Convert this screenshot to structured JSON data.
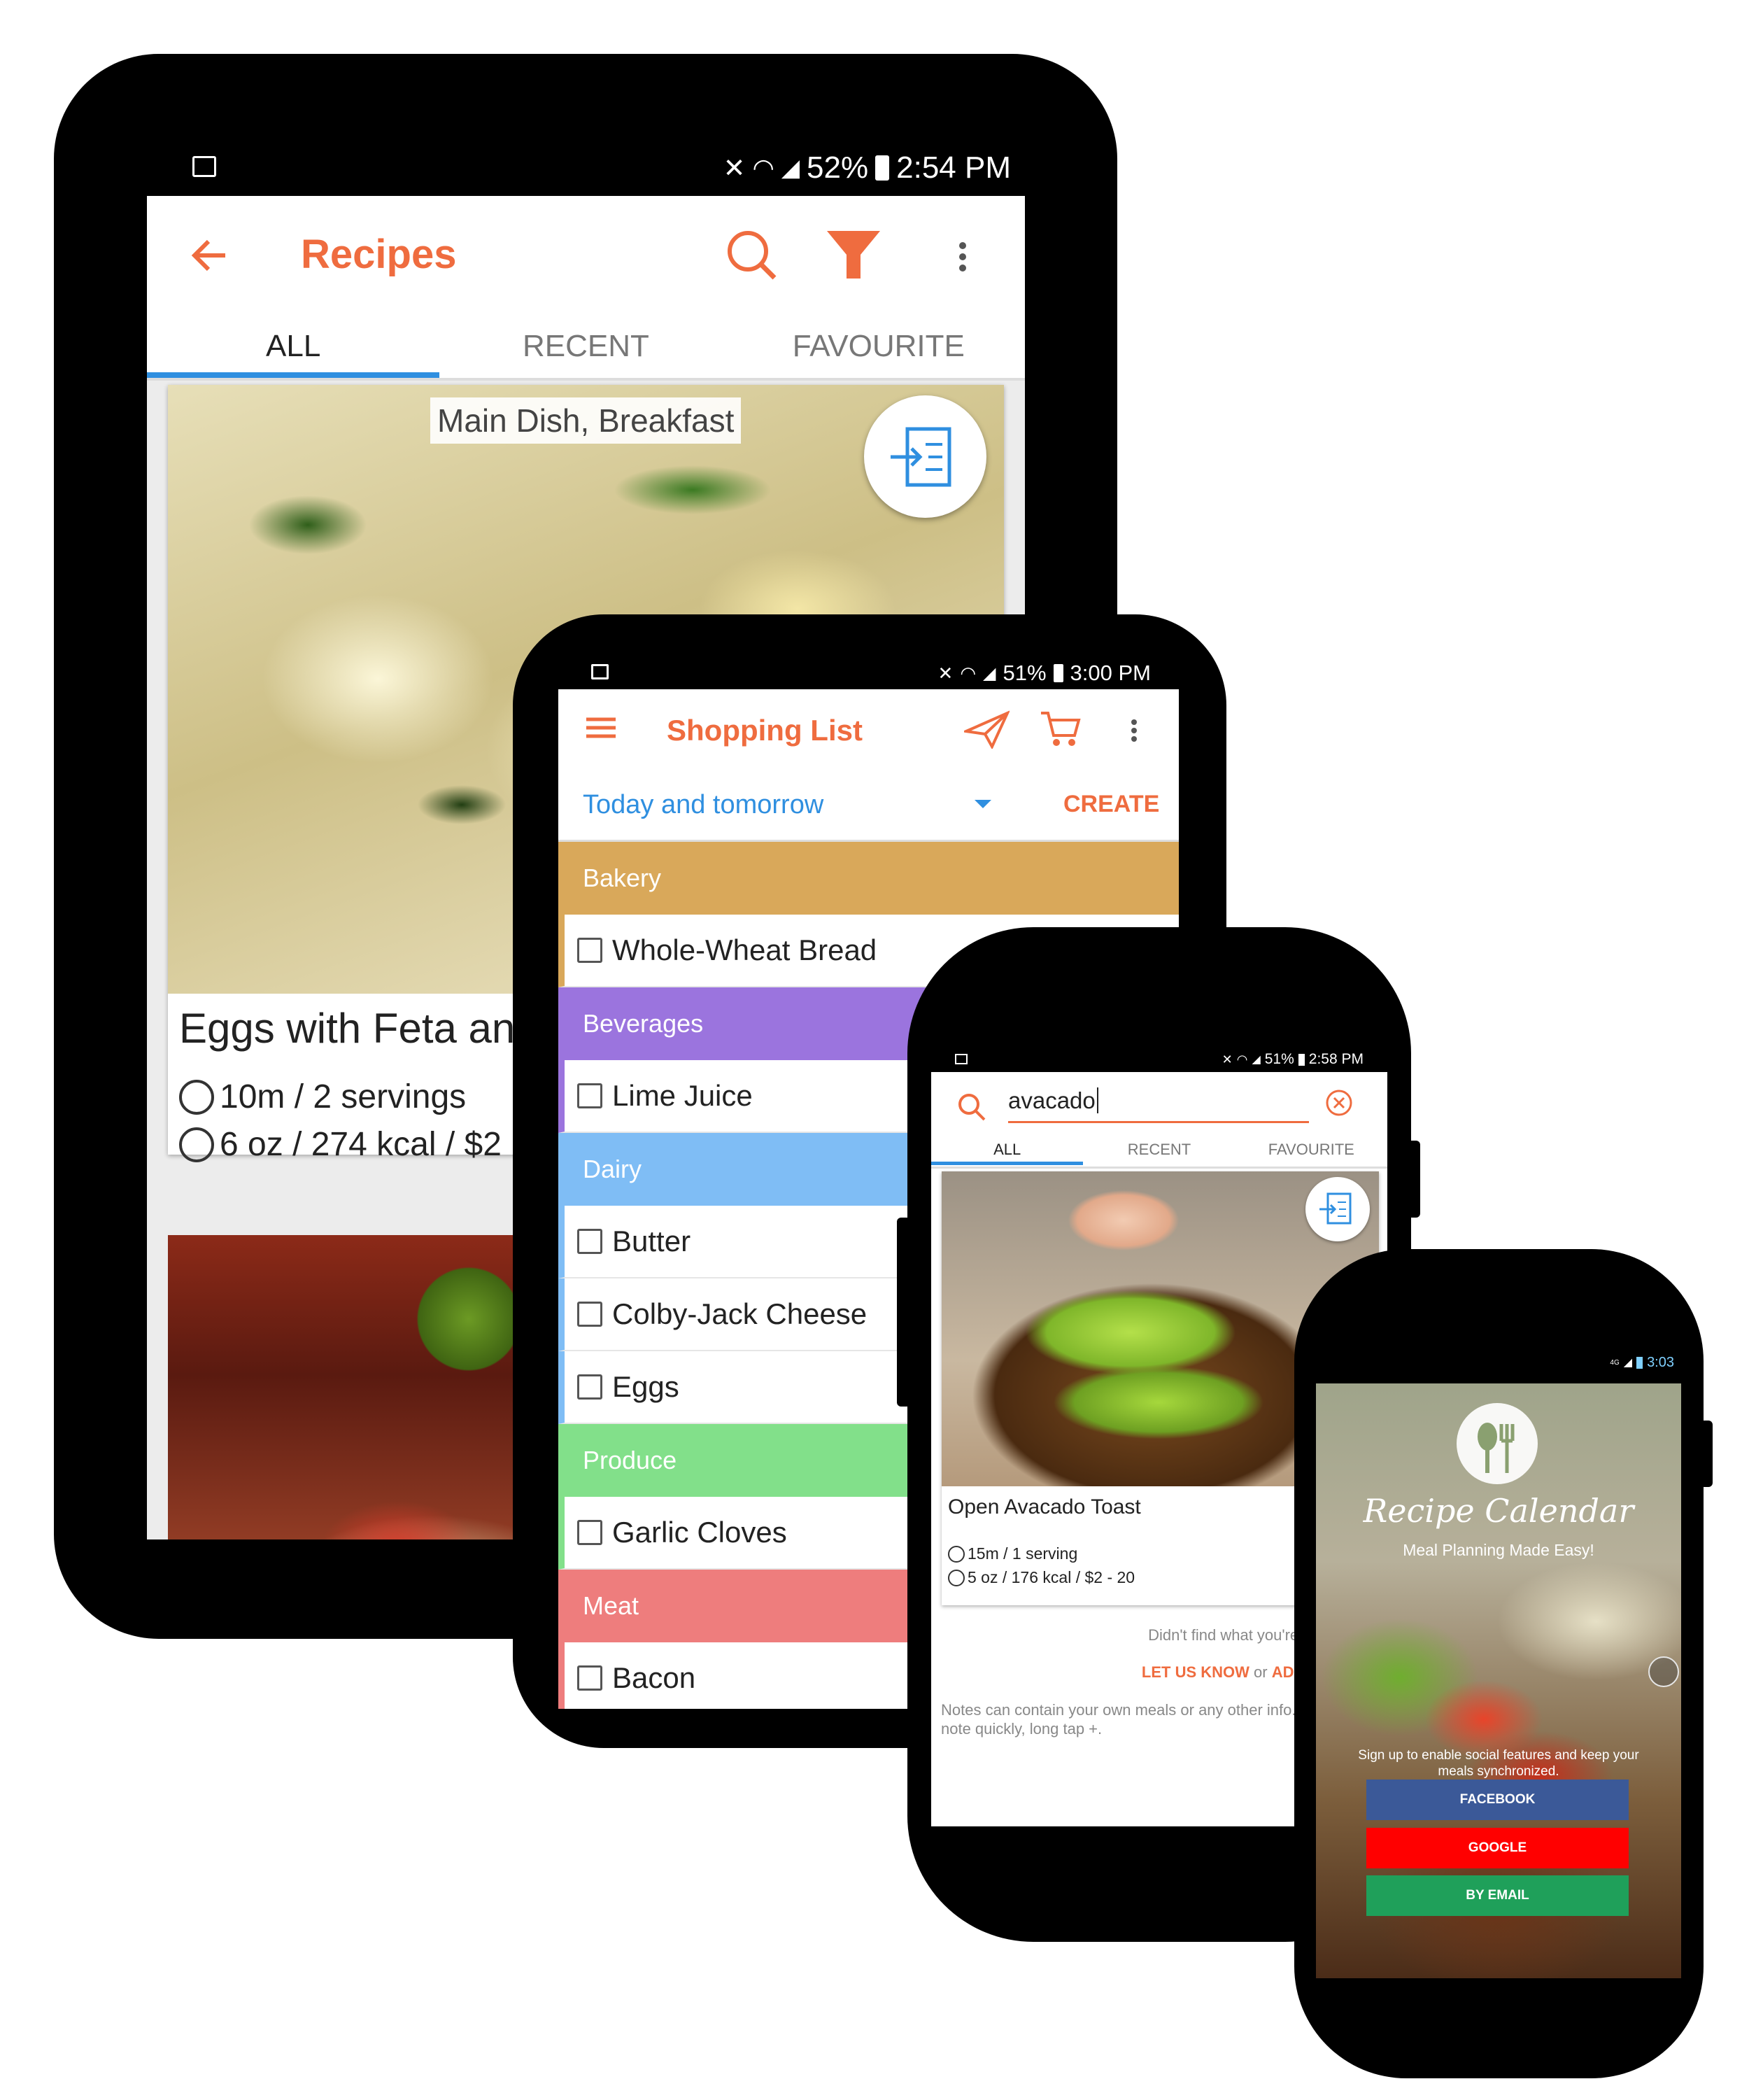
{
  "tablet_large": {
    "status": {
      "battery": "52%",
      "time": "2:54 PM"
    },
    "app_title": "Recipes",
    "tabs": [
      "ALL",
      "RECENT",
      "FAVOURITE"
    ],
    "active_tab": "ALL",
    "recipe": {
      "tag": "Main Dish, Breakfast",
      "title": "Eggs with Feta an",
      "time_servings": "10m / 2 servings",
      "nutrition": "6 oz / 274 kcal / $2"
    }
  },
  "tablet_small": {
    "status": {
      "battery": "51%",
      "time": "3:00 PM"
    },
    "app_title": "Shopping List",
    "period_select": "Today and tomorrow",
    "create_label": "CREATE",
    "categories": [
      {
        "name": "Bakery",
        "color": "#d9a85a",
        "items": [
          "Whole-Wheat Bread"
        ]
      },
      {
        "name": "Beverages",
        "color": "#9b74de",
        "items": [
          "Lime Juice"
        ]
      },
      {
        "name": "Dairy",
        "color": "#7fbdf5",
        "items": [
          "Butter",
          "Colby-Jack Cheese",
          "Eggs"
        ]
      },
      {
        "name": "Produce",
        "color": "#82e08a",
        "items": [
          "Garlic Cloves"
        ]
      },
      {
        "name": "Meat",
        "color": "#ee7d7d",
        "items": [
          "Bacon"
        ]
      }
    ]
  },
  "phone_search": {
    "status": {
      "battery": "51%",
      "time": "2:58 PM"
    },
    "search_value": "avacado",
    "tabs": [
      "ALL",
      "RECENT",
      "FAVOURITE"
    ],
    "active_tab": "ALL",
    "recipe": {
      "title": "Open Avacado Toast",
      "time_servings": "15m / 1 serving",
      "nutrition": "5 oz / 176 kcal / $2 - 20"
    },
    "not_found": "Didn't find what you're looking for?",
    "let_us_know": "LET US KNOW",
    "or": "or",
    "add_note": "ADD A NOTE",
    "notes_hint": "Notes can contain your own meals or any other info. To add a note quickly, long tap +."
  },
  "phone_login": {
    "status": {
      "network": "4G",
      "time": "3:03"
    },
    "brand": "Recipe Calendar",
    "tagline": "Meal Planning Made Easy!",
    "signup_text": "Sign up to enable social features and keep your meals synchronized.",
    "buttons": [
      {
        "label": "FACEBOOK",
        "color": "#3b5998"
      },
      {
        "label": "GOOGLE",
        "color": "#ff0000"
      },
      {
        "label": "BY EMAIL",
        "color": "#1fa05a"
      }
    ]
  },
  "colors": {
    "accent": "#ef6c3f",
    "link_blue": "#2f8fe0",
    "tab_indicator": "#2f8fe0"
  }
}
